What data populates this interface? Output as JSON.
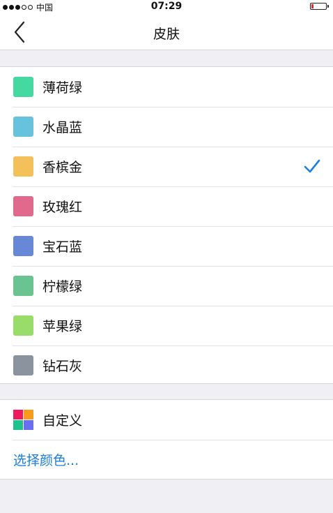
{
  "status_bar": {
    "carrier": "中国",
    "time": "07:29",
    "battery_color": "#e02d2d"
  },
  "nav": {
    "title": "皮肤"
  },
  "skins": [
    {
      "label": "薄荷绿",
      "color": "#44d9a0",
      "selected": false
    },
    {
      "label": "水晶蓝",
      "color": "#67c2dd",
      "selected": false
    },
    {
      "label": "香槟金",
      "color": "#f4c05a",
      "selected": true
    },
    {
      "label": "玫瑰红",
      "color": "#e0698c",
      "selected": false
    },
    {
      "label": "宝石蓝",
      "color": "#6788d6",
      "selected": false
    },
    {
      "label": "柠檬绿",
      "color": "#6ac491",
      "selected": false
    },
    {
      "label": "苹果绿",
      "color": "#98dd6a",
      "selected": false
    },
    {
      "label": "钻石灰",
      "color": "#8b939f",
      "selected": false
    }
  ],
  "custom": {
    "label": "自定义",
    "icon_colors": [
      "#f0185f",
      "#f89a1a",
      "#1ec28d",
      "#6b6ef0"
    ],
    "pick_color_link": "选择颜色..."
  },
  "accent_color": "#1a7fe0"
}
